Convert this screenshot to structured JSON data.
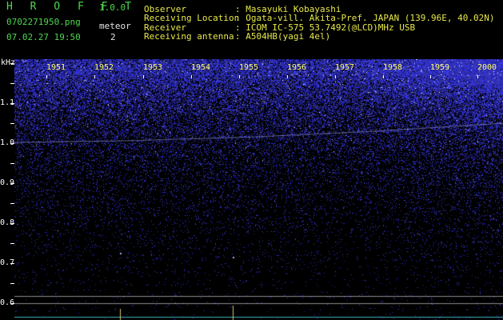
{
  "header": {
    "app_name": "H R O F F T",
    "version": "1.0.0",
    "filename": "0702271950.png",
    "datetime": "07.02.27 19:50",
    "meteor_label": "meteor",
    "meteor_count": "2",
    "fields": [
      {
        "label": "Observer",
        "value": ": Masayuki Kobayashi"
      },
      {
        "label": "Receiving Location",
        "value": ": Ogata-vill. Akita-Pref. JAPAN (139.96E, 40.02N)"
      },
      {
        "label": "Receiver",
        "value": ": ICOM IC-575 53.7492(@LCD)MHz USB"
      },
      {
        "label": "Receiving antenna",
        "value": ": A504HB(yagi 4el)"
      }
    ]
  },
  "y_axis": {
    "unit": "kHz",
    "ticks": [
      "1.1",
      "1.0",
      "0.9",
      "0.8",
      "0.7",
      "0.6"
    ]
  },
  "x_axis": {
    "ticks": [
      "1951",
      "1952",
      "1953",
      "1954",
      "1955",
      "1956",
      "1957",
      "1958",
      "1959",
      "2000"
    ]
  },
  "colors": {
    "noise": "#2a2aff",
    "header_label": "#e8e84a",
    "header_meta": "#4dd84d",
    "tick_text": "#ffff66"
  }
}
